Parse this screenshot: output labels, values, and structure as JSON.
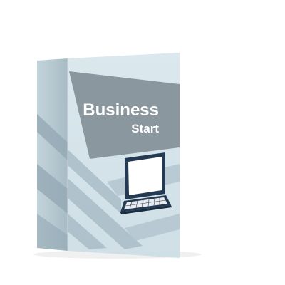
{
  "product": {
    "title": "Business",
    "subtitle": "Start"
  },
  "icons": {
    "device": "laptop-icon"
  },
  "colors": {
    "box_front": "#d6e4ea",
    "box_side": "#b6c8d1",
    "box_top": "#eef4f7",
    "banner": "#8a979e",
    "stripe": "#a9bcc6",
    "laptop_outline": "#243a52",
    "laptop_screen": "#ffffff",
    "title_text": "#ffffff"
  }
}
